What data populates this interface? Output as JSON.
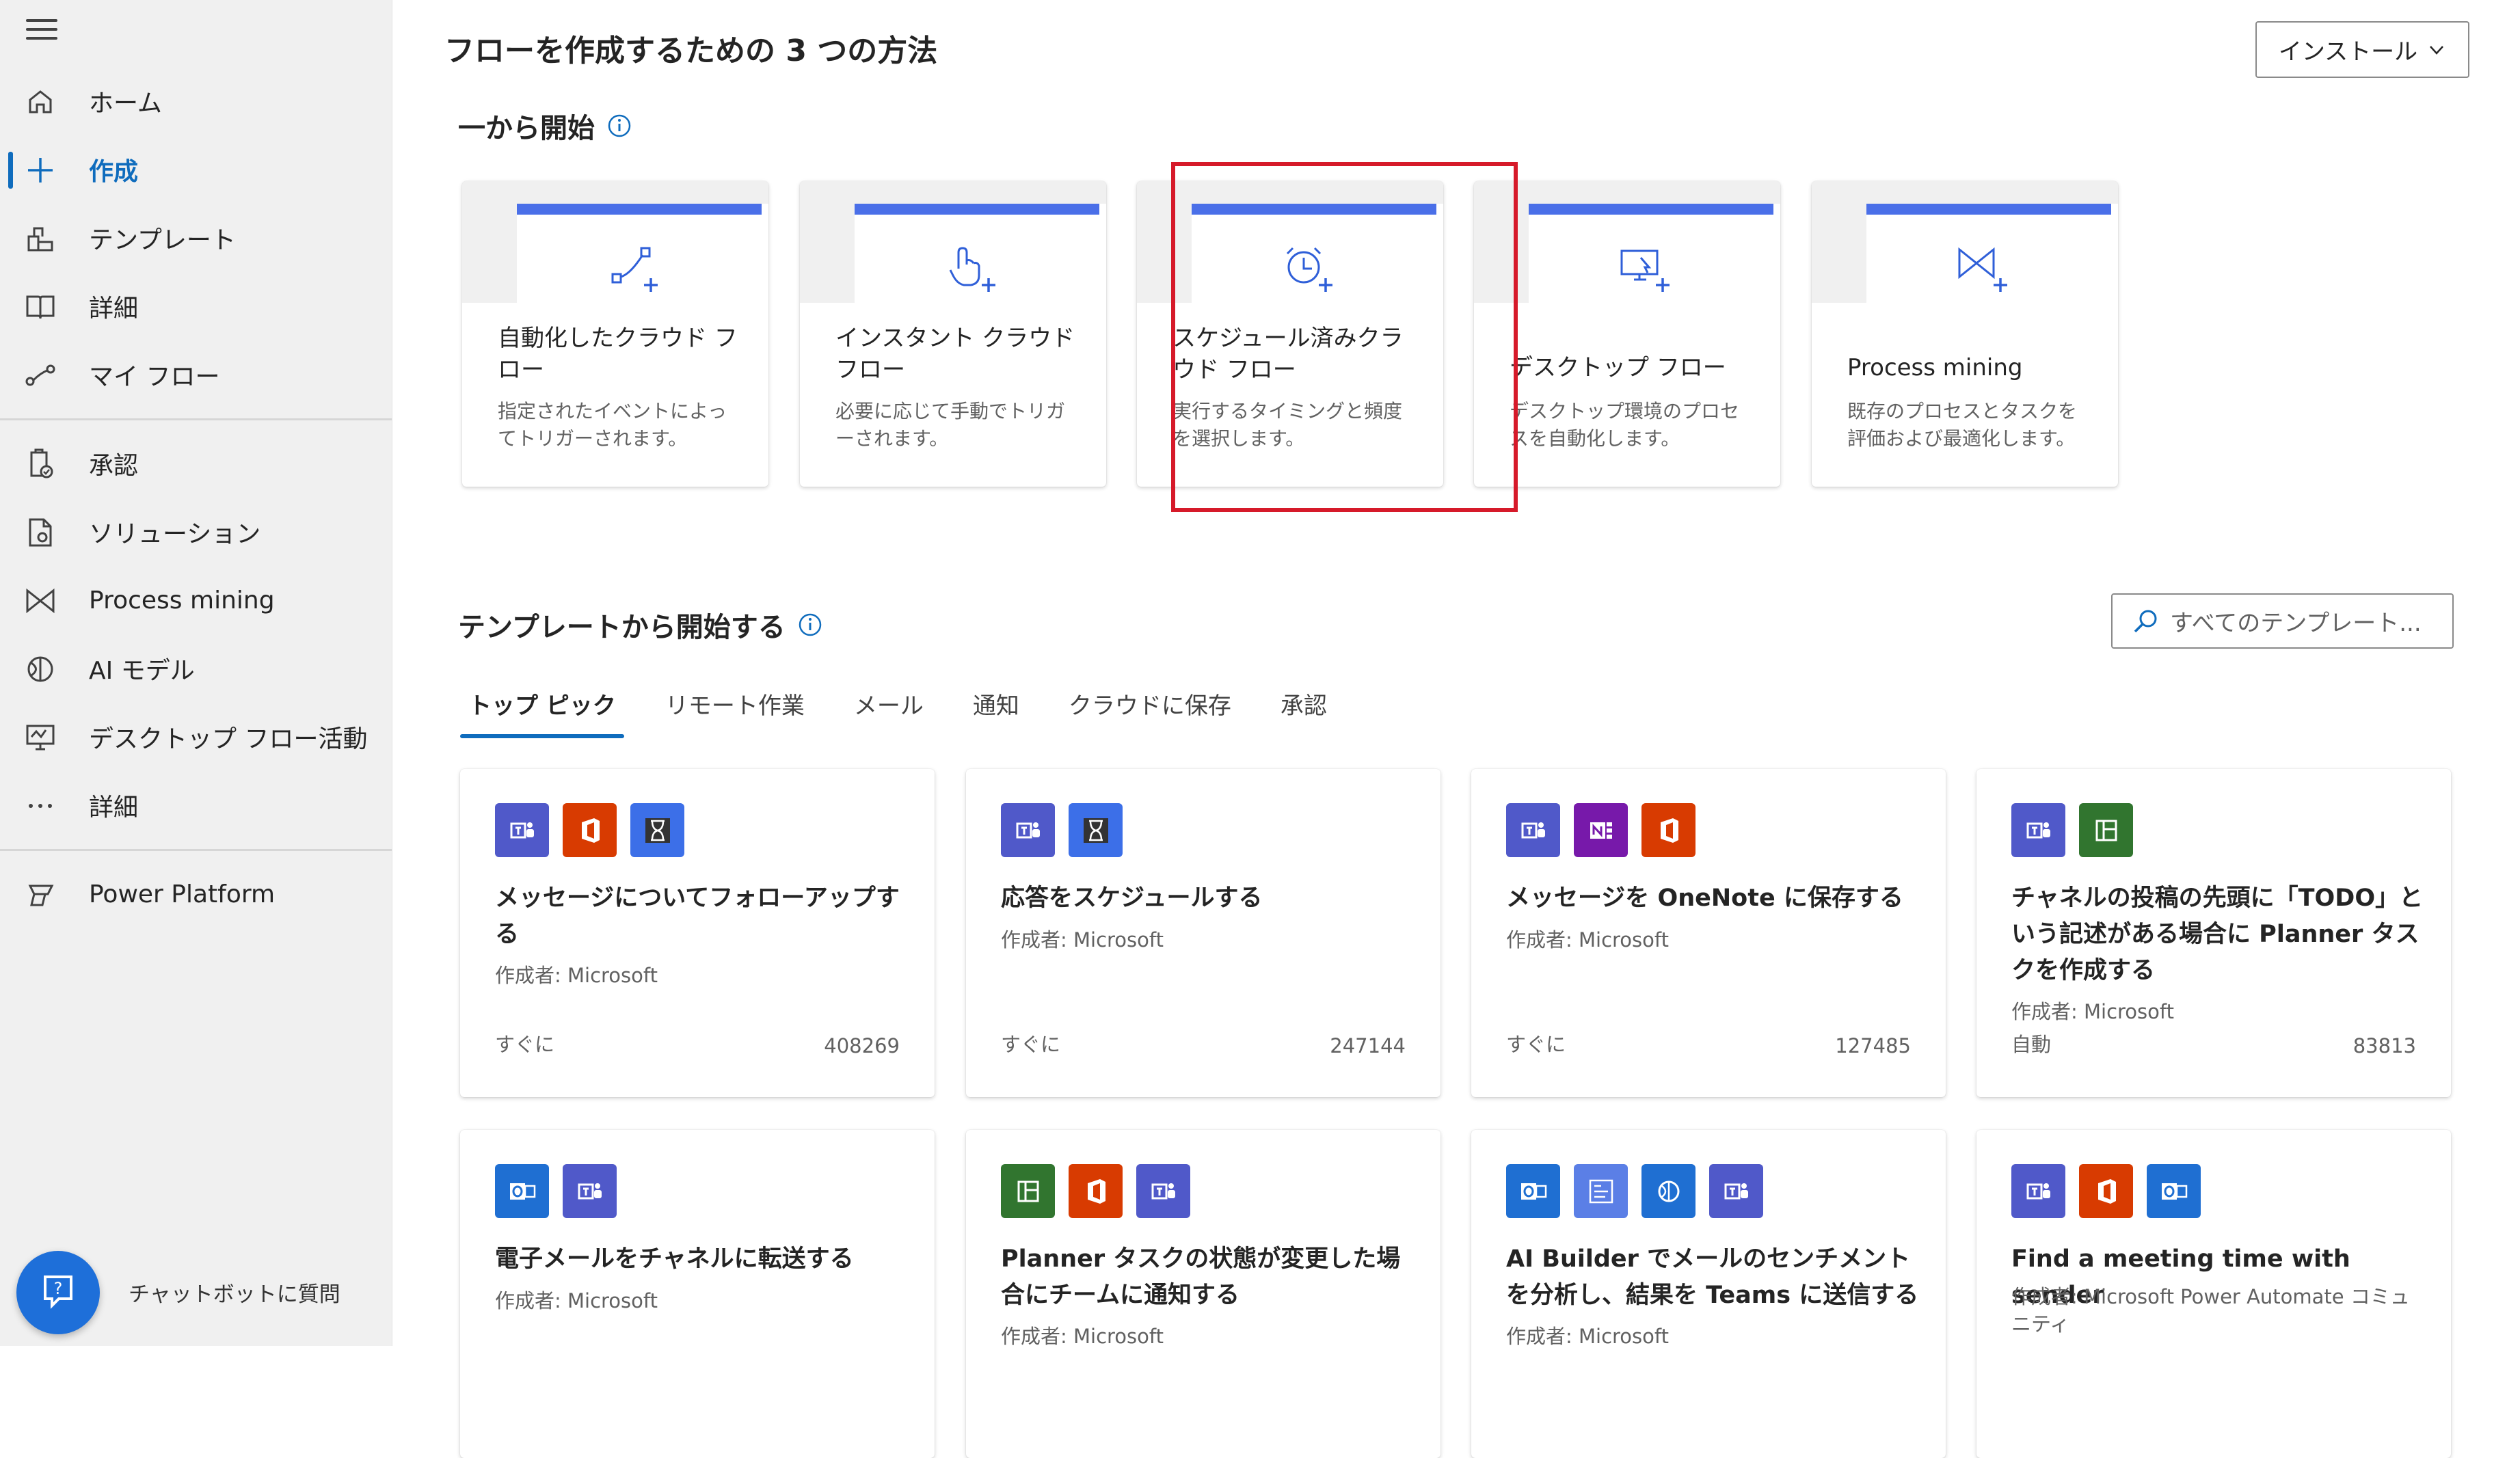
{
  "sidebar": {
    "items": [
      {
        "label": "ホーム",
        "icon": "home-icon"
      },
      {
        "label": "作成",
        "icon": "plus-icon",
        "active": true
      },
      {
        "label": "テンプレート",
        "icon": "template-icon"
      },
      {
        "label": "詳細",
        "icon": "book-icon"
      },
      {
        "label": "マイ フロー",
        "icon": "flow-icon"
      },
      {
        "label": "承認",
        "icon": "approval-icon"
      },
      {
        "label": "ソリューション",
        "icon": "solution-icon"
      },
      {
        "label": "Process mining",
        "icon": "process-mining-icon"
      },
      {
        "label": "AI モデル",
        "icon": "ai-model-icon"
      },
      {
        "label": "デスクトップ フロー活動",
        "icon": "desktop-activity-icon"
      },
      {
        "label": "詳細",
        "icon": "more-icon"
      },
      {
        "label": "Power Platform",
        "icon": "power-platform-icon"
      }
    ],
    "chatbot_label": "チャットボットに質問"
  },
  "header": {
    "title": "フローを作成するための 3 つの方法",
    "install_label": "インストール"
  },
  "scratch": {
    "title": "一から開始",
    "cards": [
      {
        "title": "自動化したクラウド フロー",
        "desc": "指定されたイベントによってトリガーされます。",
        "icon": "automated-flow-icon"
      },
      {
        "title": "インスタント クラウド フロー",
        "desc": "必要に応じて手動でトリガーされます。",
        "icon": "instant-flow-icon"
      },
      {
        "title": "スケジュール済みクラウド フロー",
        "desc": "実行するタイミングと頻度を選択します。",
        "icon": "scheduled-flow-icon"
      },
      {
        "title": "デスクトップ フロー",
        "desc": "デスクトップ環境のプロセスを自動化します。",
        "icon": "desktop-flow-icon"
      },
      {
        "title": "Process mining",
        "desc": "既存のプロセスとタスクを評価および最適化します。",
        "icon": "process-mining-icon"
      }
    ]
  },
  "templates": {
    "title": "テンプレートから開始する",
    "search_placeholder": "すべてのテンプレート...",
    "tabs": [
      "トップ ピック",
      "リモート作業",
      "メール",
      "通知",
      "クラウドに保存",
      "承認"
    ],
    "cards": [
      {
        "title": "メッセージについてフォローアップする",
        "author": "作成者: Microsoft",
        "type": "すぐに",
        "count": "408269",
        "icons": [
          "teams",
          "office",
          "timer"
        ]
      },
      {
        "title": "応答をスケジュールする",
        "author": "作成者: Microsoft",
        "type": "すぐに",
        "count": "247144",
        "icons": [
          "teams",
          "timer"
        ]
      },
      {
        "title": "メッセージを OneNote に保存する",
        "author": "作成者: Microsoft",
        "type": "すぐに",
        "count": "127485",
        "icons": [
          "teams",
          "onenote",
          "office"
        ]
      },
      {
        "title": "チャネルの投稿の先頭に「TODO」という記述がある場合に Planner タスクを作成する",
        "author": "作成者: Microsoft",
        "type": "自動",
        "count": "83813",
        "icons": [
          "teams",
          "planner"
        ]
      },
      {
        "title": "電子メールをチャネルに転送する",
        "author": "作成者: Microsoft",
        "type": "",
        "count": "",
        "icons": [
          "outlook",
          "teams"
        ]
      },
      {
        "title": "Planner タスクの状態が変更した場合にチームに通知する",
        "author": "作成者: Microsoft",
        "type": "",
        "count": "",
        "icons": [
          "planner",
          "office",
          "teams"
        ]
      },
      {
        "title": "AI Builder でメールのセンチメントを分析し、結果を Teams に送信する",
        "author": "作成者: Microsoft",
        "type": "",
        "count": "",
        "icons": [
          "outlook",
          "data",
          "ai-builder",
          "teams"
        ]
      },
      {
        "title": "Find a meeting time with sender",
        "author": "作成者: Microsoft Power Automate コミュニティ",
        "type": "",
        "count": "",
        "icons": [
          "teams",
          "office",
          "outlook"
        ]
      }
    ]
  },
  "colors": {
    "accent": "#0f6cbd",
    "card_band": "#4a6fe8",
    "highlight": "#d61a2a",
    "teams": "#5059c9",
    "office": "#d83b01",
    "timer": "#3c6fe8",
    "onenote": "#7719aa",
    "planner": "#31752f",
    "outlook": "#1f6fd2"
  }
}
